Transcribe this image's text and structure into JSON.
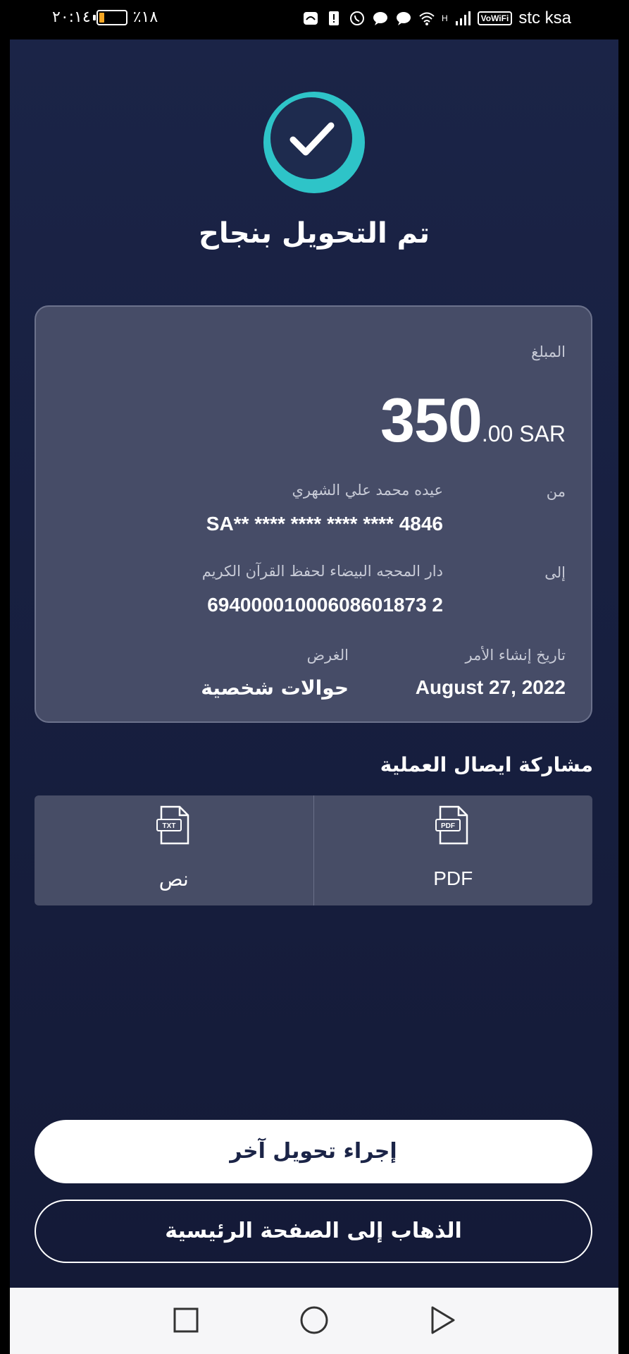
{
  "status_bar": {
    "time": "٢٠:١٤",
    "battery_percent": "٪١٨",
    "carrier": "stc ksa",
    "vowifi_label": "VoWiFi",
    "network_label": "H"
  },
  "header": {
    "title": "تم التحويل بنجاح"
  },
  "receipt": {
    "amount_label": "المبلغ",
    "amount_integer": "350",
    "amount_decimal": ".00 SAR",
    "from_label": "من",
    "from_name": "عيده محمد علي الشهري",
    "from_account": "SA** **** **** **** **** 4846",
    "to_label": "إلى",
    "to_name": "دار المحجه البيضاء لحفظ القرآن الكريم",
    "to_account": "69400001000608601873 2",
    "date_label": "تاريخ إنشاء الأمر",
    "date_value": "August 27, 2022",
    "purpose_label": "الغرض",
    "purpose_value": "حوالات شخصية"
  },
  "share": {
    "title": "مشاركة ايصال العملية",
    "pdf_label": "PDF",
    "pdf_icon_text": "PDF",
    "text_label": "نص",
    "text_icon_text": "TXT"
  },
  "actions": {
    "another_transfer": "إجراء تحويل آخر",
    "go_home": "الذهاب إلى الصفحة الرئيسية"
  },
  "colors": {
    "background": "#1b2447",
    "card": "#464c67",
    "success_teal": "#2ec4c8",
    "button_text": "#1b2447"
  }
}
